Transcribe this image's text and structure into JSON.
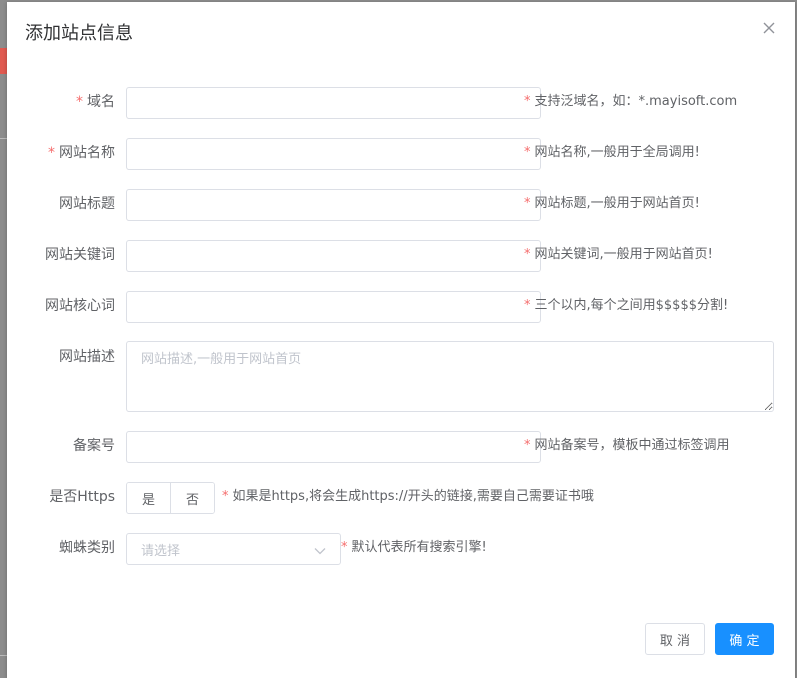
{
  "dialog": {
    "title": "添加站点信息",
    "close_icon": "close-icon"
  },
  "form": {
    "domain": {
      "label": "域名",
      "required": "*",
      "value": "",
      "hint_star": "*",
      "hint": "支持泛域名，如：*.mayisoft.com"
    },
    "site_name": {
      "label": "网站名称",
      "required": "*",
      "value": "",
      "hint_star": "*",
      "hint": "网站名称,一般用于全局调用!"
    },
    "site_title": {
      "label": "网站标题",
      "value": "",
      "hint_star": "*",
      "hint": "网站标题,一般用于网站首页!"
    },
    "keywords": {
      "label": "网站关键词",
      "value": "",
      "hint_star": "*",
      "hint": "网站关键词,一般用于网站首页!"
    },
    "core_words": {
      "label": "网站核心词",
      "value": "",
      "hint_star": "*",
      "hint": "三个以内,每个之间用$$$$$分割!"
    },
    "description": {
      "label": "网站描述",
      "value": "",
      "placeholder": "网站描述,一般用于网站首页"
    },
    "icp": {
      "label": "备案号",
      "value": "",
      "hint_star": "*",
      "hint": "网站备案号，模板中通过标签调用"
    },
    "https": {
      "label": "是否Https",
      "options": [
        "是",
        "否"
      ],
      "hint_star": "*",
      "hint": "如果是https,将会生成https://开头的链接,需要自己需要证书哦"
    },
    "spider": {
      "label": "蜘蛛类别",
      "placeholder": "请选择",
      "hint_star": "*",
      "hint": "默认代表所有搜索引擎!",
      "icon": "chevron-down-icon"
    }
  },
  "footer": {
    "cancel_label": "取 消",
    "ok_label": "确 定"
  },
  "colors": {
    "accent": "#1890ff",
    "required": "#f56c6c"
  }
}
